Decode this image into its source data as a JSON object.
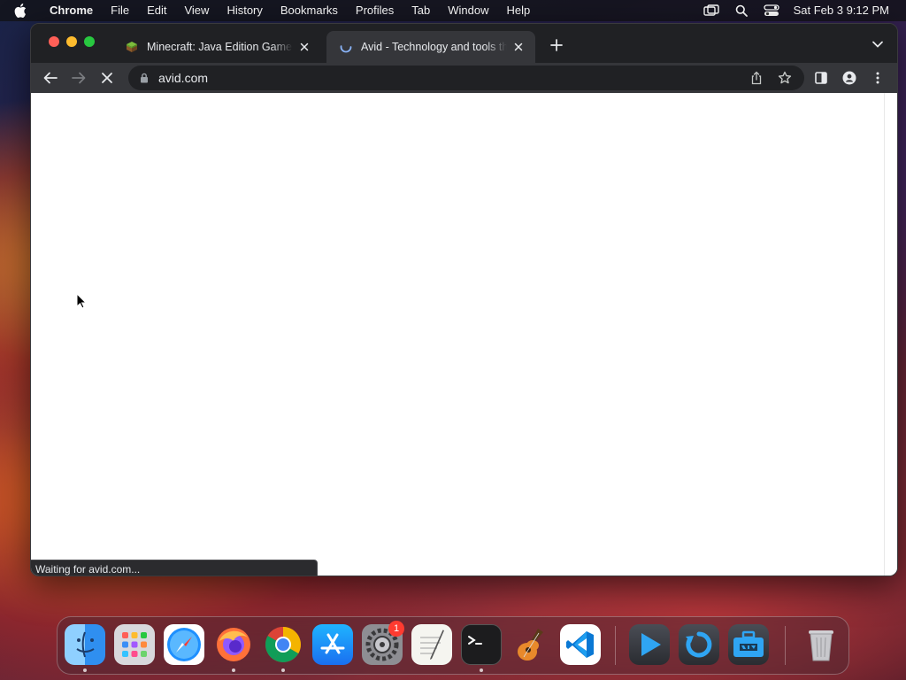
{
  "menubar": {
    "app_name": "Chrome",
    "items": [
      "File",
      "Edit",
      "View",
      "History",
      "Bookmarks",
      "Profiles",
      "Tab",
      "Window",
      "Help"
    ],
    "status_icons": [
      "screen-mirroring-icon",
      "spotlight-search-icon",
      "control-center-icon"
    ],
    "clock": "Sat Feb 3  9:12 PM"
  },
  "browser": {
    "tabs": [
      {
        "title": "Minecraft: Java Edition Game C",
        "favicon": "minecraft-grass-block-icon",
        "active": false
      },
      {
        "title": "Avid - Technology and tools th",
        "favicon": "loading-spinner-icon",
        "active": true
      }
    ],
    "address_bar": {
      "url": "avid.com",
      "secure_icon": "lock-icon"
    },
    "status_text": "Waiting for avid.com...",
    "loading": true
  },
  "dock": {
    "apps": [
      {
        "name": "Finder",
        "running": true
      },
      {
        "name": "Launchpad",
        "running": false
      },
      {
        "name": "Safari",
        "running": false
      },
      {
        "name": "Firefox",
        "running": true
      },
      {
        "name": "Google Chrome",
        "running": true
      },
      {
        "name": "App Store",
        "running": false
      },
      {
        "name": "System Preferences",
        "running": false,
        "badge": "1"
      },
      {
        "name": "TextEdit",
        "running": false
      },
      {
        "name": "Terminal",
        "running": true
      },
      {
        "name": "GarageBand",
        "running": false
      },
      {
        "name": "Visual Studio Code",
        "running": false
      },
      {
        "name": "DivX Player",
        "running": false
      },
      {
        "name": "DivX Converter",
        "running": false
      },
      {
        "name": "DivX Toolbox",
        "running": false
      },
      {
        "name": "Trash",
        "running": false
      }
    ]
  },
  "colors": {
    "window_bg": "#202124",
    "toolbar_bg": "#35363a",
    "accent_spinner": "#8ab4f8",
    "close_light": "#ff5f57",
    "minimize_light": "#febc2e",
    "zoom_light": "#28c840"
  }
}
